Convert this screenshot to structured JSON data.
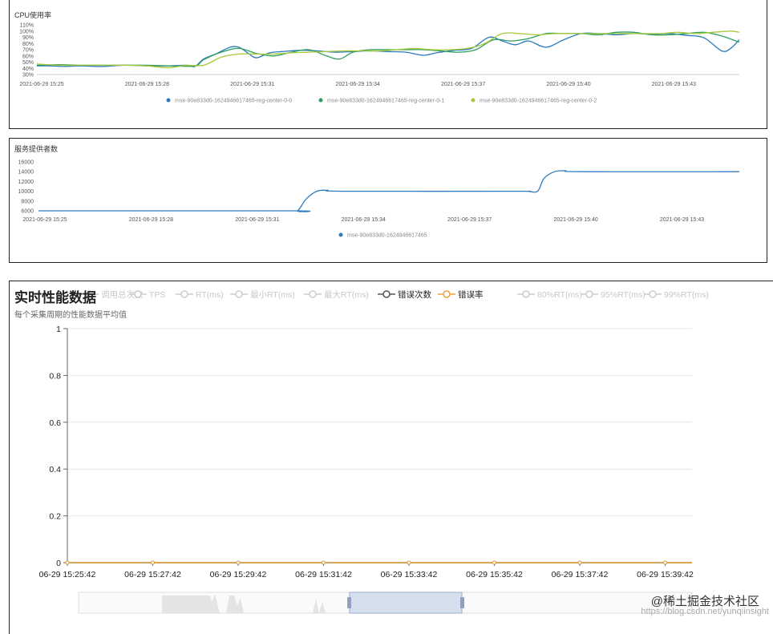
{
  "panels": {
    "cpu": {
      "title": "CPU使用率"
    },
    "providers": {
      "title": "服务提供者数"
    },
    "realtime": {
      "title": "实时性能数据",
      "subtitle": "每个采集周期的性能数据平均值"
    }
  },
  "watermark": {
    "site": "@稀土掘金技术社区",
    "url": "https://blog.csdn.net/yunqiinsight"
  },
  "colors": {
    "blue": "#2c7bbf",
    "green": "#2e9e5e",
    "lime": "#a6c93a",
    "orange": "#e6a23c",
    "grid": "#e6e6e6"
  },
  "chart_data": [
    {
      "type": "line",
      "title": "CPU使用率",
      "x": [
        "2021-06-29 15:25",
        "2021-06-29 15:28",
        "2021-06-29 15:31",
        "2021-06-29 15:34",
        "2021-06-29 15:37",
        "2021-06-29 15:40",
        "2021-06-29 15:43"
      ],
      "x_ticks": [
        "2021-06-29 15:25",
        "2021-06-29 15:28",
        "2021-06-29 15:31",
        "2021-06-29 15:34",
        "2021-06-29 15:37",
        "2021-06-29 15:40",
        "2021-06-29 15:43"
      ],
      "y_ticks": [
        "110%",
        "100%",
        "90%",
        "80%",
        "70%",
        "60%",
        "50%",
        "40%",
        "30%"
      ],
      "ylim": [
        30,
        110
      ],
      "legend": "bottom",
      "series": [
        {
          "name": "mse-90e833d0-1624946617465-reg-center-0-0",
          "color": "#2c7bbf",
          "points": [
            [
              0,
              44
            ],
            [
              0.3,
              44
            ],
            [
              0.6,
              43
            ],
            [
              1,
              44
            ],
            [
              1.5,
              43
            ],
            [
              2,
              45
            ],
            [
              2.5,
              44
            ],
            [
              3,
              44
            ],
            [
              3.4,
              45
            ],
            [
              3.6,
              43
            ],
            [
              3.8,
              55
            ],
            [
              4.1,
              64
            ],
            [
              4.4,
              74
            ],
            [
              4.6,
              74
            ],
            [
              4.8,
              65
            ],
            [
              5.0,
              57
            ],
            [
              5.3,
              65
            ],
            [
              5.6,
              67
            ],
            [
              6.0,
              69
            ],
            [
              6.4,
              68
            ],
            [
              6.8,
              66
            ],
            [
              7.2,
              67
            ],
            [
              7.6,
              68
            ],
            [
              8.0,
              67
            ],
            [
              8.4,
              66
            ],
            [
              8.8,
              61
            ],
            [
              9.1,
              65
            ],
            [
              9.5,
              69
            ],
            [
              9.9,
              72
            ],
            [
              10.3,
              90
            ],
            [
              10.6,
              84
            ],
            [
              10.9,
              78
            ],
            [
              11.2,
              84
            ],
            [
              11.6,
              74
            ],
            [
              12.0,
              86
            ],
            [
              12.4,
              96
            ],
            [
              12.8,
              96
            ],
            [
              13.2,
              94
            ],
            [
              13.6,
              96
            ],
            [
              14.0,
              95
            ],
            [
              14.4,
              96
            ],
            [
              14.8,
              93
            ],
            [
              15.2,
              89
            ],
            [
              15.6,
              68
            ],
            [
              15.8,
              72
            ],
            [
              16.0,
              86
            ]
          ]
        },
        {
          "name": "mse-90e833d0-1624946617465-reg-center-0-1",
          "color": "#2e9e5e",
          "points": [
            [
              0,
              45
            ],
            [
              0.5,
              46
            ],
            [
              1,
              45
            ],
            [
              1.5,
              45
            ],
            [
              2,
              45
            ],
            [
              2.5,
              45
            ],
            [
              3,
              44
            ],
            [
              3.6,
              44
            ],
            [
              3.8,
              54
            ],
            [
              4.2,
              66
            ],
            [
              4.6,
              72
            ],
            [
              5.0,
              64
            ],
            [
              5.4,
              60
            ],
            [
              5.8,
              66
            ],
            [
              6.2,
              70
            ],
            [
              6.6,
              60
            ],
            [
              6.9,
              55
            ],
            [
              7.2,
              66
            ],
            [
              7.6,
              70
            ],
            [
              8.0,
              70
            ],
            [
              8.4,
              70
            ],
            [
              8.8,
              70
            ],
            [
              9.2,
              68
            ],
            [
              9.6,
              66
            ],
            [
              10.0,
              70
            ],
            [
              10.4,
              86
            ],
            [
              10.8,
              84
            ],
            [
              11.2,
              88
            ],
            [
              11.6,
              96
            ],
            [
              12.0,
              96
            ],
            [
              12.4,
              96
            ],
            [
              12.8,
              94
            ],
            [
              13.2,
              98
            ],
            [
              13.6,
              98
            ],
            [
              14.0,
              94
            ],
            [
              14.4,
              94
            ],
            [
              14.8,
              96
            ],
            [
              15.2,
              98
            ],
            [
              15.6,
              92
            ],
            [
              16.0,
              82
            ]
          ]
        },
        {
          "name": "mse-90e833d0-1624946617465-reg-center-0-2",
          "color": "#a6c93a",
          "points": [
            [
              0,
              47
            ],
            [
              0.5,
              45
            ],
            [
              1,
              45
            ],
            [
              1.5,
              45
            ],
            [
              2,
              45
            ],
            [
              2.5,
              44
            ],
            [
              3.0,
              41
            ],
            [
              3.4,
              45
            ],
            [
              3.8,
              45
            ],
            [
              4.2,
              58
            ],
            [
              4.6,
              63
            ],
            [
              5.0,
              63
            ],
            [
              5.4,
              63
            ],
            [
              5.8,
              65
            ],
            [
              6.2,
              66
            ],
            [
              6.6,
              67
            ],
            [
              7.0,
              68
            ],
            [
              7.4,
              68
            ],
            [
              7.8,
              68
            ],
            [
              8.2,
              70
            ],
            [
              8.6,
              72
            ],
            [
              9.0,
              70
            ],
            [
              9.4,
              70
            ],
            [
              9.8,
              72
            ],
            [
              10.2,
              80
            ],
            [
              10.6,
              96
            ],
            [
              11.0,
              96
            ],
            [
              11.4,
              94
            ],
            [
              11.8,
              96
            ],
            [
              12.2,
              96
            ],
            [
              12.6,
              96
            ],
            [
              13.0,
              96
            ],
            [
              13.4,
              96
            ],
            [
              13.8,
              96
            ],
            [
              14.2,
              96
            ],
            [
              14.6,
              98
            ],
            [
              15.0,
              96
            ],
            [
              15.4,
              98
            ],
            [
              15.8,
              100
            ],
            [
              16.0,
              98
            ]
          ]
        }
      ]
    },
    {
      "type": "line",
      "title": "服务提供者数",
      "x_ticks": [
        "2021-06-29 15:25",
        "2021-06-29 15:28",
        "2021-06-29 15:31",
        "2021-06-29 15:34",
        "2021-06-29 15:37",
        "2021-06-29 15:40",
        "2021-06-29 15:43"
      ],
      "y_ticks": [
        "16000",
        "14000",
        "12000",
        "10000",
        "8000",
        "6000"
      ],
      "ylim": [
        6000,
        16000
      ],
      "legend": "bottom",
      "series": [
        {
          "name": "mse-90e833d0-1624946617465",
          "color": "#2c7bbf",
          "points": [
            [
              0,
              6000
            ],
            [
              5.9,
              6000
            ],
            [
              6.1,
              6000
            ],
            [
              6.3,
              8400
            ],
            [
              6.55,
              10000
            ],
            [
              6.8,
              10200
            ],
            [
              7.2,
              10000
            ],
            [
              11.2,
              10000
            ],
            [
              11.5,
              10000
            ],
            [
              11.75,
              10000
            ],
            [
              11.9,
              12600
            ],
            [
              12.15,
              14000
            ],
            [
              12.4,
              14200
            ],
            [
              12.8,
              14000
            ],
            [
              16.5,
              14000
            ]
          ]
        }
      ]
    },
    {
      "type": "line",
      "title": "实时性能数据",
      "subtitle": "每个采集周期的性能数据平均值",
      "legend_items": [
        {
          "label": "调用总次数",
          "active": false,
          "color": "#cccccc"
        },
        {
          "label": "TPS",
          "active": false,
          "color": "#cccccc"
        },
        {
          "label": "RT(ms)",
          "active": false,
          "color": "#cccccc"
        },
        {
          "label": "最小RT(ms)",
          "active": false,
          "color": "#cccccc"
        },
        {
          "label": "最大RT(ms)",
          "active": false,
          "color": "#cccccc"
        },
        {
          "label": "错误次数",
          "active": true,
          "color": "#555555"
        },
        {
          "label": "错误率",
          "active": true,
          "color": "#e6a23c"
        },
        {
          "label": "80%RT(ms)",
          "active": false,
          "color": "#cccccc"
        },
        {
          "label": "95%RT(ms)",
          "active": false,
          "color": "#cccccc"
        },
        {
          "label": "99%RT(ms)",
          "active": false,
          "color": "#cccccc"
        }
      ],
      "x_ticks": [
        "06-29 15:25:42",
        "06-29 15:27:42",
        "06-29 15:29:42",
        "06-29 15:31:42",
        "06-29 15:33:42",
        "06-29 15:35:42",
        "06-29 15:37:42",
        "06-29 15:39:42"
      ],
      "y_ticks": [
        "1",
        "0.8",
        "0.6",
        "0.4",
        "0.2",
        "0"
      ],
      "ylim": [
        0,
        1
      ],
      "series": [
        {
          "name": "错误次数",
          "color": "#555555",
          "values": [
            0,
            0,
            0,
            0,
            0,
            0,
            0,
            0
          ]
        },
        {
          "name": "错误率",
          "color": "#e6a23c",
          "values": [
            0,
            0,
            0,
            0,
            0,
            0,
            0,
            0
          ]
        }
      ]
    }
  ]
}
